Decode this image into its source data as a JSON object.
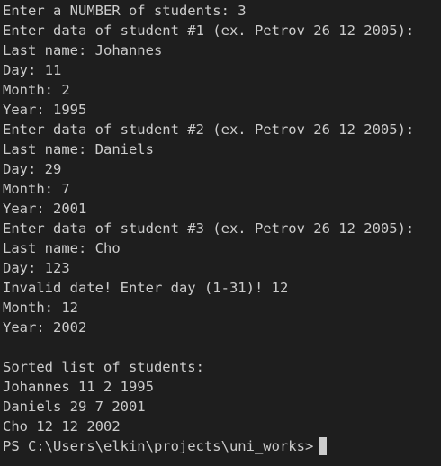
{
  "terminal": {
    "lines": [
      "Enter a NUMBER of students: 3",
      "Enter data of student #1 (ex. Petrov 26 12 2005):",
      "Last name: Johannes",
      "Day: 11",
      "Month: 2",
      "Year: 1995",
      "Enter data of student #2 (ex. Petrov 26 12 2005):",
      "Last name: Daniels",
      "Day: 29",
      "Month: 7",
      "Year: 2001",
      "Enter data of student #3 (ex. Petrov 26 12 2005):",
      "Last name: Cho",
      "Day: 123",
      "Invalid date! Enter day (1-31)! 12",
      "Month: 12",
      "Year: 2002",
      "",
      "Sorted list of students:",
      "Johannes 11 2 1995",
      "Daniels 29 7 2001",
      "Cho 12 12 2002"
    ],
    "prompt": "PS C:\\Users\\elkin\\projects\\uni_works>"
  },
  "colors": {
    "background": "#1e1e1e",
    "foreground": "#cccccc",
    "cursor": "#cccccc"
  }
}
